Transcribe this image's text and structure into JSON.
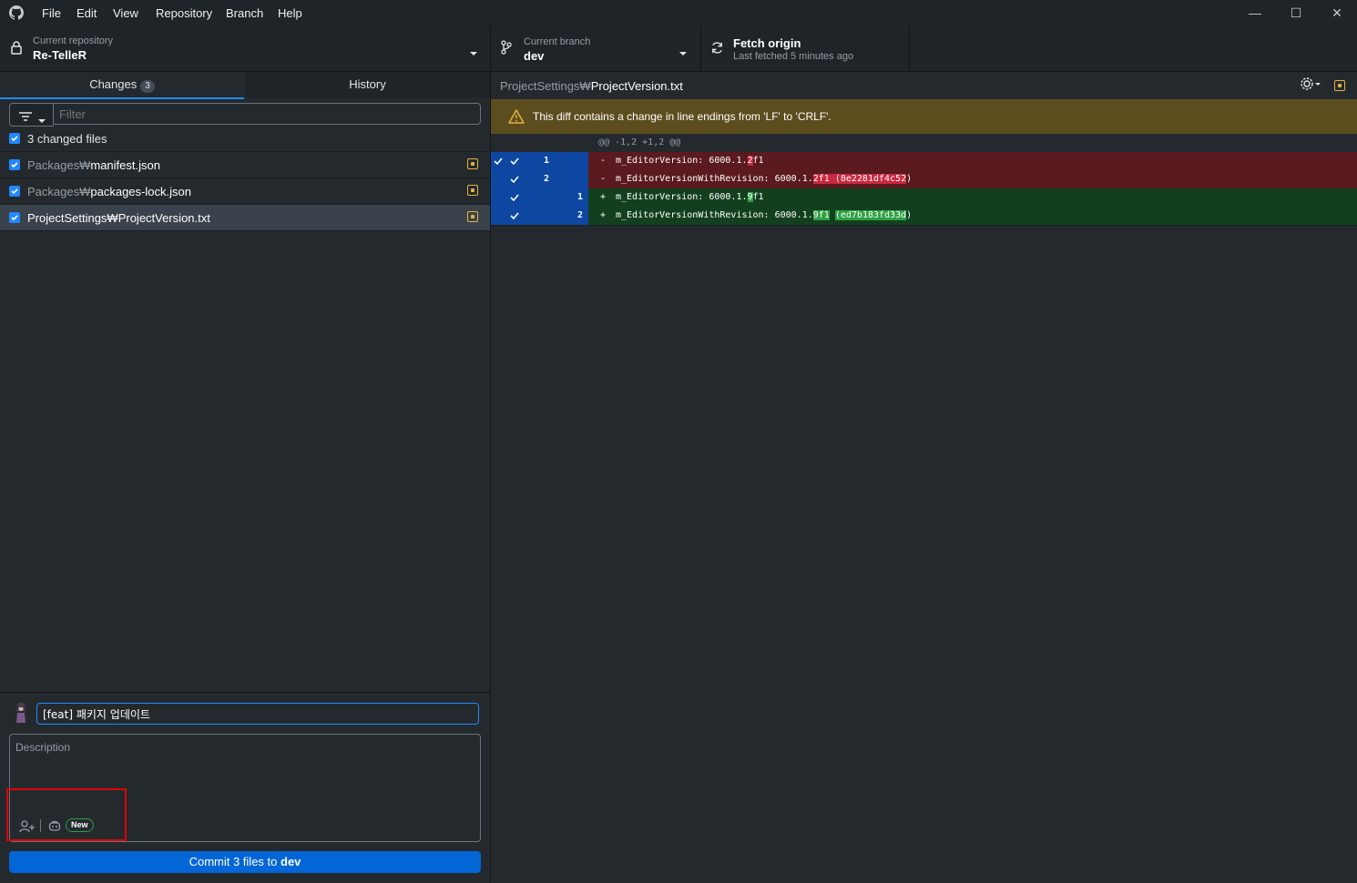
{
  "menu": [
    "File",
    "Edit",
    "View",
    "Repository",
    "Branch",
    "Help"
  ],
  "window_controls": {
    "minimize": "—",
    "maximize": "☐",
    "close": "✕"
  },
  "toolbar": {
    "repo_label": "Current repository",
    "repo_name": "Re-TelleR",
    "branch_label": "Current branch",
    "branch_name": "dev",
    "fetch_title": "Fetch origin",
    "fetch_sub": "Last fetched 5 minutes ago"
  },
  "tabs": {
    "changes": "Changes",
    "changes_count": "3",
    "history": "History"
  },
  "filter": {
    "placeholder": "Filter"
  },
  "changed_summary": "3 changed files",
  "files": [
    {
      "dir": "Packages₩",
      "name": "manifest.json"
    },
    {
      "dir": "Packages₩",
      "name": "packages-lock.json"
    },
    {
      "dir": "ProjectSettings₩",
      "name": "ProjectVersion.txt"
    }
  ],
  "diff": {
    "path_dir": "ProjectSettings₩",
    "path_file": "ProjectVersion.txt",
    "warning": "This diff contains a change in line endings from 'LF' to 'CRLF'.",
    "hunk": "@@ -1,2 +1,2 @@",
    "lines": [
      {
        "old": "1",
        "new": "",
        "sign": "-",
        "pre": "m_EditorVersion: 6000.1.",
        "hl": "2",
        "post": "f1"
      },
      {
        "old": "2",
        "new": "",
        "sign": "-",
        "pre": "m_EditorVersionWithRevision: 6000.1.",
        "hl": "2f1 (8e2281df4c52",
        "post": ")"
      },
      {
        "old": "",
        "new": "1",
        "sign": "+",
        "pre": "m_EditorVersion: 6000.1.",
        "hl": "9",
        "post": "f1"
      },
      {
        "old": "",
        "new": "2",
        "sign": "+",
        "pre": "m_EditorVersionWithRevision: 6000.1.",
        "hl": "9f1",
        "mid": " ",
        "hl2": "(ed7b183fd33d",
        "post": ")"
      }
    ]
  },
  "commit": {
    "summary": "[feat] 패키지 업데이트",
    "description_placeholder": "Description",
    "new_badge": "New",
    "button_prefix": "Commit 3 files to ",
    "button_branch": "dev"
  },
  "colors": {
    "accent": "#2188ff",
    "warning_bg": "#5c4d1e",
    "deleted": "#5a1a1f",
    "added": "#12401f",
    "highlight_box": "#e00000"
  }
}
